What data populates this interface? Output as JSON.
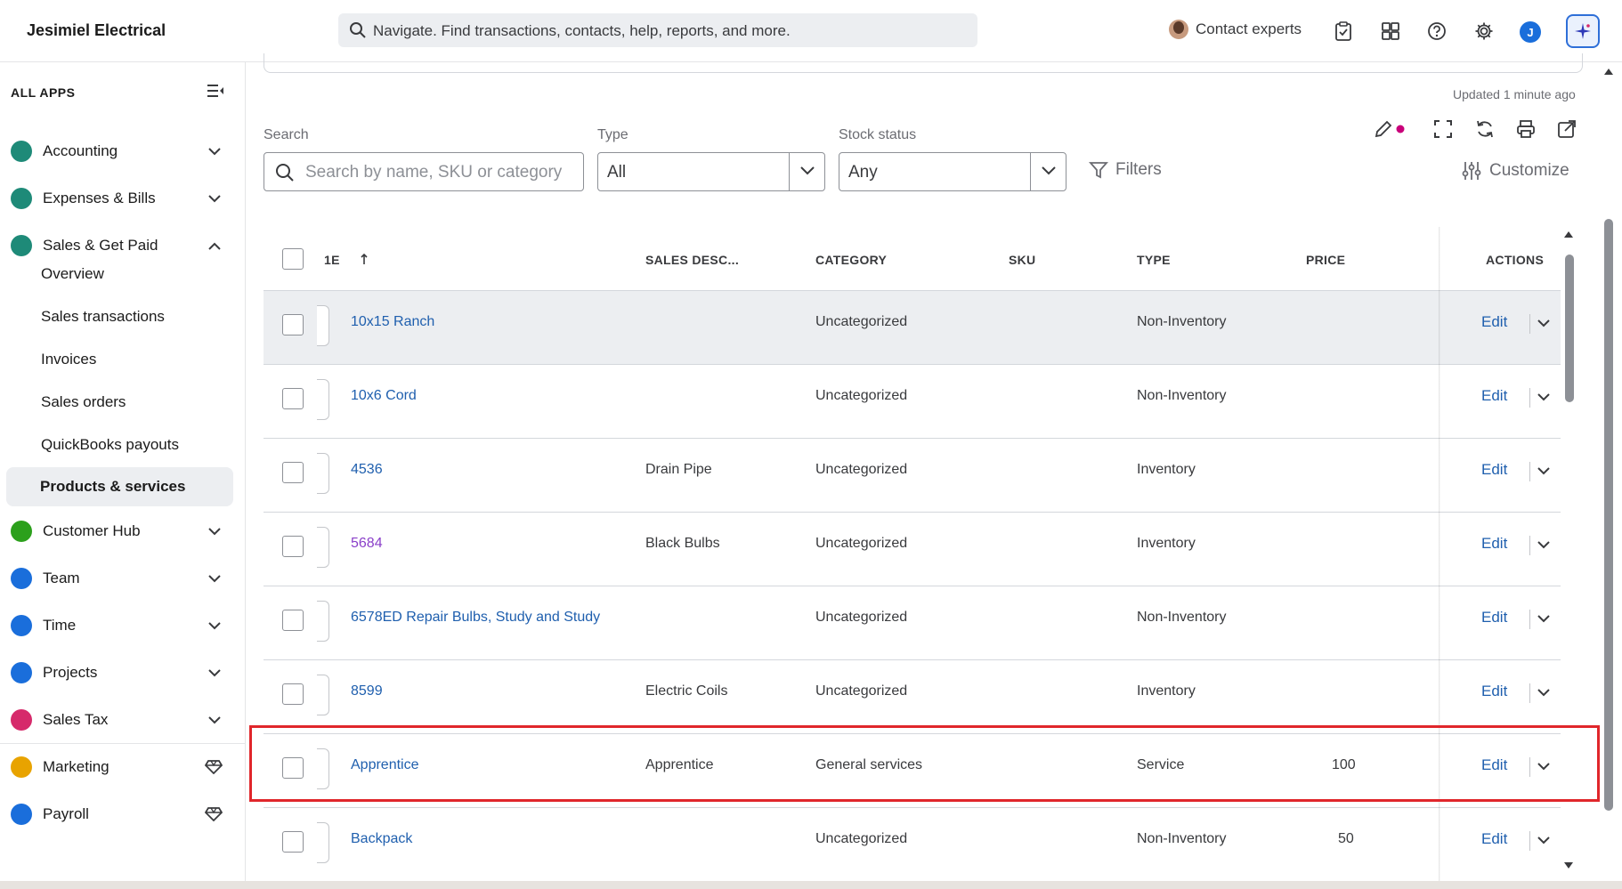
{
  "header": {
    "company": "Jesimiel Electrical",
    "search_placeholder": "Navigate. Find transactions, contacts, help, reports, and more.",
    "contact_experts": "Contact experts",
    "user_initial": "J"
  },
  "sidebar": {
    "all_apps": "ALL APPS",
    "items": [
      {
        "label": "Accounting",
        "color": "#1e8a78"
      },
      {
        "label": "Expenses & Bills",
        "color": "#1e8a78"
      },
      {
        "label": "Sales & Get Paid",
        "color": "#1e8a78"
      },
      {
        "label": "Customer Hub",
        "color": "#2ca01c"
      },
      {
        "label": "Team",
        "color": "#1a6edb"
      },
      {
        "label": "Time",
        "color": "#1a6edb"
      },
      {
        "label": "Projects",
        "color": "#1a6edb"
      },
      {
        "label": "Sales Tax",
        "color": "#d62a6b"
      },
      {
        "label": "Marketing",
        "color": "#e8a300"
      },
      {
        "label": "Payroll",
        "color": "#1a6edb"
      }
    ],
    "sub_items": [
      "Overview",
      "Sales transactions",
      "Invoices",
      "Sales orders",
      "QuickBooks payouts",
      "Products & services"
    ]
  },
  "toolbar": {
    "updated": "Updated 1 minute ago",
    "search_label": "Search",
    "search_placeholder": "Search by name, SKU or category",
    "type_label": "Type",
    "type_value": "All",
    "stock_label": "Stock status",
    "stock_value": "Any",
    "filters": "Filters",
    "customize": "Customize"
  },
  "table": {
    "headers": {
      "name": "1E",
      "sales_desc": "SALES DESC...",
      "category": "CATEGORY",
      "sku": "SKU",
      "type": "TYPE",
      "price": "PRICE",
      "actions": "ACTIONS"
    },
    "edit_label": "Edit",
    "rows": [
      {
        "name": "10x15 Ranch",
        "desc": "",
        "category": "Uncategorized",
        "sku": "",
        "type": "Non-Inventory",
        "price": ""
      },
      {
        "name": "10x6 Cord",
        "desc": "",
        "category": "Uncategorized",
        "sku": "",
        "type": "Non-Inventory",
        "price": ""
      },
      {
        "name": "4536",
        "desc": "Drain Pipe",
        "category": "Uncategorized",
        "sku": "",
        "type": "Inventory",
        "price": ""
      },
      {
        "name": "5684",
        "desc": "Black Bulbs",
        "category": "Uncategorized",
        "sku": "",
        "type": "Inventory",
        "price": ""
      },
      {
        "name": "6578ED Repair Bulbs, Study and Study",
        "desc": "",
        "category": "Uncategorized",
        "sku": "",
        "type": "Non-Inventory",
        "price": ""
      },
      {
        "name": "8599",
        "desc": "Electric Coils",
        "category": "Uncategorized",
        "sku": "",
        "type": "Inventory",
        "price": ""
      },
      {
        "name": "Apprentice",
        "desc": "Apprentice",
        "category": "General services",
        "sku": "",
        "type": "Service",
        "price": "100"
      },
      {
        "name": "Backpack",
        "desc": "",
        "category": "Uncategorized",
        "sku": "",
        "type": "Non-Inventory",
        "price": "50"
      }
    ]
  }
}
